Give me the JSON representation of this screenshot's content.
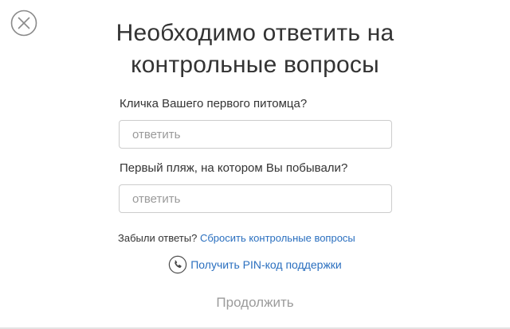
{
  "dialog": {
    "close_icon": "close-circle-icon",
    "title_line1": "Необходимо ответить на",
    "title_line2": "контрольные вопросы"
  },
  "questions": [
    {
      "label": "Кличка Вашего первого питомца?",
      "value": "",
      "placeholder": "ответить"
    },
    {
      "label": "Первый пляж, на котором Вы побывали?",
      "value": "",
      "placeholder": "ответить"
    }
  ],
  "forgot": {
    "prefix": "Забыли ответы?",
    "link": "Сбросить контрольные вопросы"
  },
  "support": {
    "icon": "phone-circle-icon",
    "link": "Получить PIN-код поддержки"
  },
  "actions": {
    "continue_label": "Продолжить"
  },
  "colors": {
    "link": "#2a6fbf",
    "text": "#333333",
    "disabled": "#9b9b9b",
    "border": "#cccccc"
  }
}
